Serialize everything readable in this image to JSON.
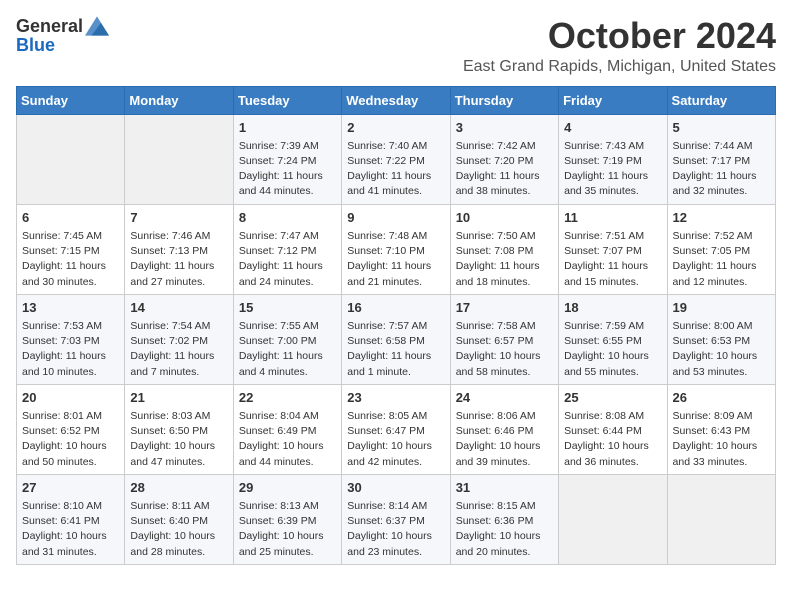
{
  "header": {
    "logo_general": "General",
    "logo_blue": "Blue",
    "month_title": "October 2024",
    "location": "East Grand Rapids, Michigan, United States"
  },
  "days_of_week": [
    "Sunday",
    "Monday",
    "Tuesday",
    "Wednesday",
    "Thursday",
    "Friday",
    "Saturday"
  ],
  "weeks": [
    [
      {
        "day": "",
        "info": ""
      },
      {
        "day": "",
        "info": ""
      },
      {
        "day": "1",
        "info": "Sunrise: 7:39 AM\nSunset: 7:24 PM\nDaylight: 11 hours and 44 minutes."
      },
      {
        "day": "2",
        "info": "Sunrise: 7:40 AM\nSunset: 7:22 PM\nDaylight: 11 hours and 41 minutes."
      },
      {
        "day": "3",
        "info": "Sunrise: 7:42 AM\nSunset: 7:20 PM\nDaylight: 11 hours and 38 minutes."
      },
      {
        "day": "4",
        "info": "Sunrise: 7:43 AM\nSunset: 7:19 PM\nDaylight: 11 hours and 35 minutes."
      },
      {
        "day": "5",
        "info": "Sunrise: 7:44 AM\nSunset: 7:17 PM\nDaylight: 11 hours and 32 minutes."
      }
    ],
    [
      {
        "day": "6",
        "info": "Sunrise: 7:45 AM\nSunset: 7:15 PM\nDaylight: 11 hours and 30 minutes."
      },
      {
        "day": "7",
        "info": "Sunrise: 7:46 AM\nSunset: 7:13 PM\nDaylight: 11 hours and 27 minutes."
      },
      {
        "day": "8",
        "info": "Sunrise: 7:47 AM\nSunset: 7:12 PM\nDaylight: 11 hours and 24 minutes."
      },
      {
        "day": "9",
        "info": "Sunrise: 7:48 AM\nSunset: 7:10 PM\nDaylight: 11 hours and 21 minutes."
      },
      {
        "day": "10",
        "info": "Sunrise: 7:50 AM\nSunset: 7:08 PM\nDaylight: 11 hours and 18 minutes."
      },
      {
        "day": "11",
        "info": "Sunrise: 7:51 AM\nSunset: 7:07 PM\nDaylight: 11 hours and 15 minutes."
      },
      {
        "day": "12",
        "info": "Sunrise: 7:52 AM\nSunset: 7:05 PM\nDaylight: 11 hours and 12 minutes."
      }
    ],
    [
      {
        "day": "13",
        "info": "Sunrise: 7:53 AM\nSunset: 7:03 PM\nDaylight: 11 hours and 10 minutes."
      },
      {
        "day": "14",
        "info": "Sunrise: 7:54 AM\nSunset: 7:02 PM\nDaylight: 11 hours and 7 minutes."
      },
      {
        "day": "15",
        "info": "Sunrise: 7:55 AM\nSunset: 7:00 PM\nDaylight: 11 hours and 4 minutes."
      },
      {
        "day": "16",
        "info": "Sunrise: 7:57 AM\nSunset: 6:58 PM\nDaylight: 11 hours and 1 minute."
      },
      {
        "day": "17",
        "info": "Sunrise: 7:58 AM\nSunset: 6:57 PM\nDaylight: 10 hours and 58 minutes."
      },
      {
        "day": "18",
        "info": "Sunrise: 7:59 AM\nSunset: 6:55 PM\nDaylight: 10 hours and 55 minutes."
      },
      {
        "day": "19",
        "info": "Sunrise: 8:00 AM\nSunset: 6:53 PM\nDaylight: 10 hours and 53 minutes."
      }
    ],
    [
      {
        "day": "20",
        "info": "Sunrise: 8:01 AM\nSunset: 6:52 PM\nDaylight: 10 hours and 50 minutes."
      },
      {
        "day": "21",
        "info": "Sunrise: 8:03 AM\nSunset: 6:50 PM\nDaylight: 10 hours and 47 minutes."
      },
      {
        "day": "22",
        "info": "Sunrise: 8:04 AM\nSunset: 6:49 PM\nDaylight: 10 hours and 44 minutes."
      },
      {
        "day": "23",
        "info": "Sunrise: 8:05 AM\nSunset: 6:47 PM\nDaylight: 10 hours and 42 minutes."
      },
      {
        "day": "24",
        "info": "Sunrise: 8:06 AM\nSunset: 6:46 PM\nDaylight: 10 hours and 39 minutes."
      },
      {
        "day": "25",
        "info": "Sunrise: 8:08 AM\nSunset: 6:44 PM\nDaylight: 10 hours and 36 minutes."
      },
      {
        "day": "26",
        "info": "Sunrise: 8:09 AM\nSunset: 6:43 PM\nDaylight: 10 hours and 33 minutes."
      }
    ],
    [
      {
        "day": "27",
        "info": "Sunrise: 8:10 AM\nSunset: 6:41 PM\nDaylight: 10 hours and 31 minutes."
      },
      {
        "day": "28",
        "info": "Sunrise: 8:11 AM\nSunset: 6:40 PM\nDaylight: 10 hours and 28 minutes."
      },
      {
        "day": "29",
        "info": "Sunrise: 8:13 AM\nSunset: 6:39 PM\nDaylight: 10 hours and 25 minutes."
      },
      {
        "day": "30",
        "info": "Sunrise: 8:14 AM\nSunset: 6:37 PM\nDaylight: 10 hours and 23 minutes."
      },
      {
        "day": "31",
        "info": "Sunrise: 8:15 AM\nSunset: 6:36 PM\nDaylight: 10 hours and 20 minutes."
      },
      {
        "day": "",
        "info": ""
      },
      {
        "day": "",
        "info": ""
      }
    ]
  ]
}
